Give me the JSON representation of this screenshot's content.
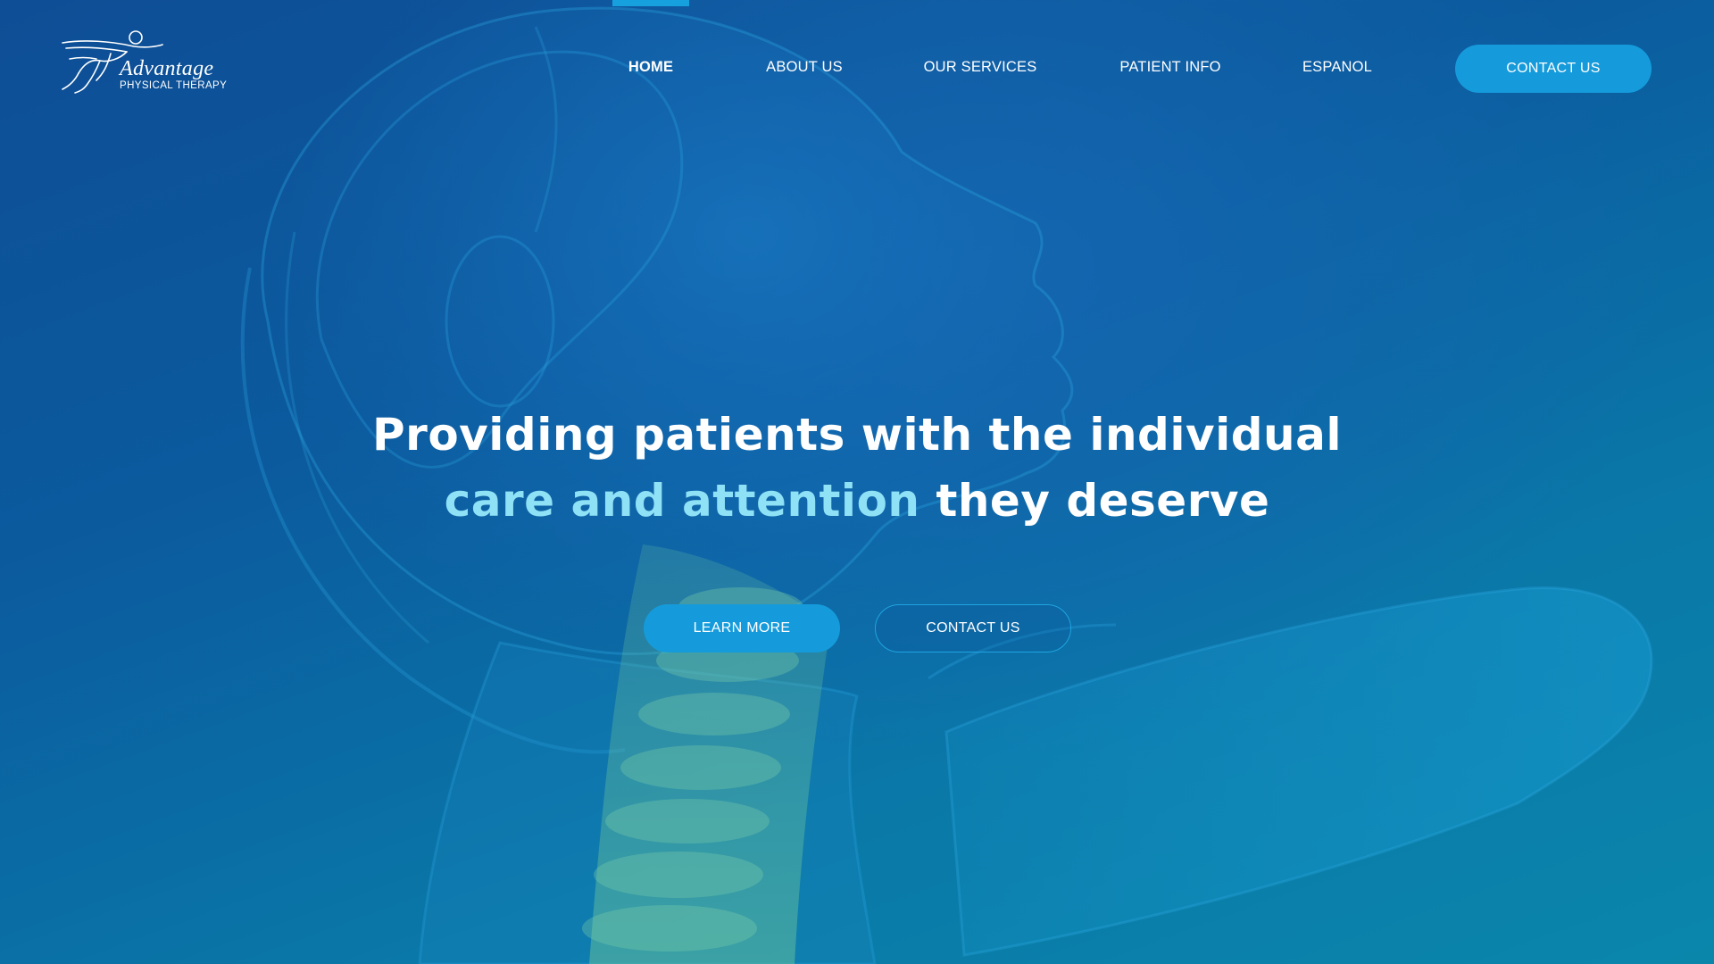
{
  "brand": {
    "name": "Advantage",
    "tagline": "PHYSICAL THERAPY"
  },
  "nav": {
    "items": [
      {
        "label": "HOME",
        "active": true
      },
      {
        "label": "ABOUT US",
        "active": false
      },
      {
        "label": "OUR SERVICES",
        "active": false
      },
      {
        "label": "PATIENT INFO",
        "active": false
      },
      {
        "label": "ESPANOL",
        "active": false
      }
    ],
    "cta_label": "CONTACT US"
  },
  "hero": {
    "line1": "Providing patients with the individual",
    "line2_accent": "care and attention",
    "line2_rest": " they deserve",
    "primary_button": "LEARN MORE",
    "secondary_button": "CONTACT US"
  },
  "colors": {
    "accent": "#159bdb",
    "highlight_text": "#8fe1f6",
    "background": "#0b5a9e"
  },
  "icons": {
    "logo": "runner-figure-logo"
  }
}
